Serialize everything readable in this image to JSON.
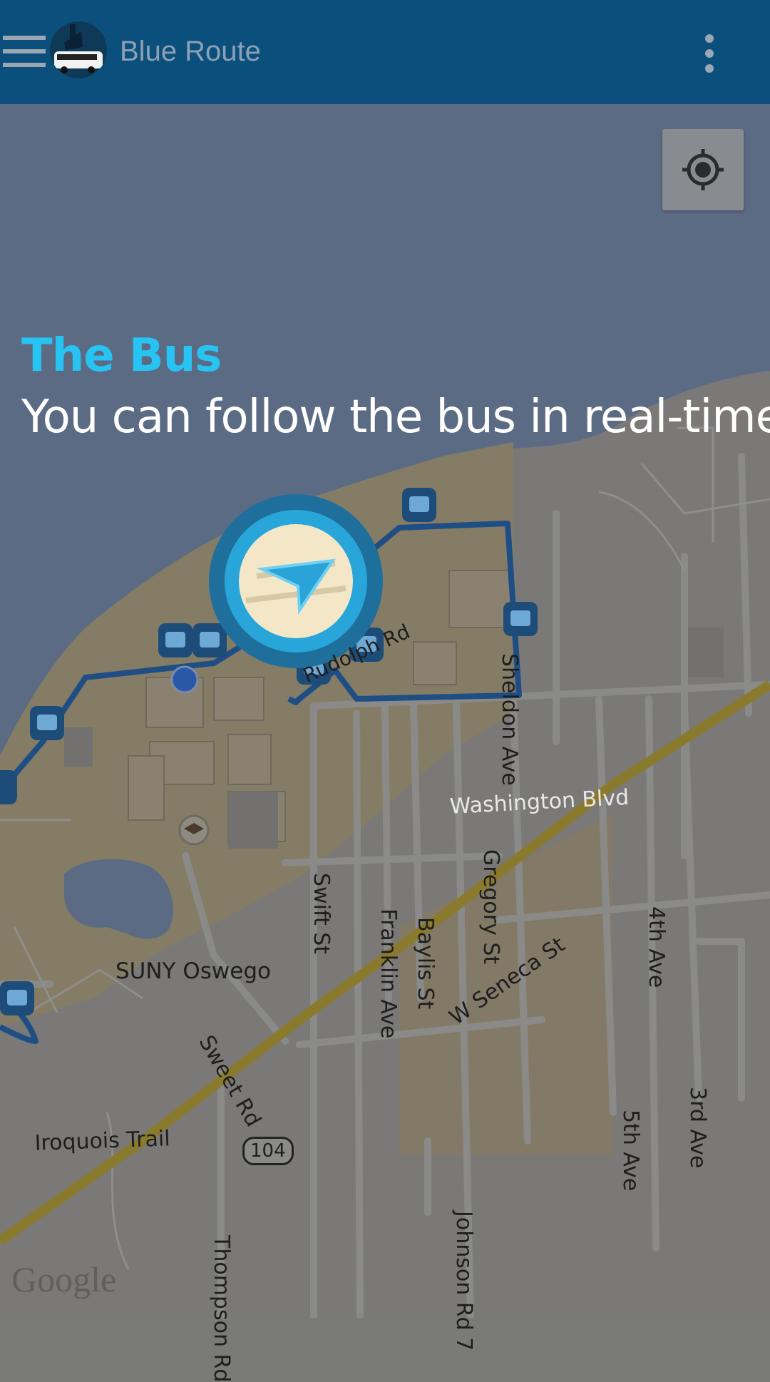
{
  "app_bar": {
    "title": "Blue Route",
    "menu_icon": "hamburger-menu-icon",
    "logo_icon": "bus-logo-icon",
    "overflow_icon": "more-vertical-icon"
  },
  "map": {
    "locate_button_icon": "my-location-icon",
    "attribution": "Google",
    "labels": {
      "suny": "SUNY Oswego",
      "washington": "Washington Blvd",
      "sheldon": "Sheldon Ave",
      "swift": "Swift St",
      "franklin": "Franklin Ave",
      "baylis": "Baylis St",
      "gregory": "Gregory St",
      "seneca": "W Seneca St",
      "fourth": "4th Ave",
      "fifth": "5th Ave",
      "third": "3rd Ave",
      "sweet": "Sweet Rd",
      "iroquois": "Iroquois Trail",
      "route104": "104",
      "thompson": "Thompson Rd",
      "johnson": "Johnson Rd 7",
      "rudolph": "Rudolph Rd"
    }
  },
  "tutorial": {
    "title": "The Bus",
    "body": "You can follow the bus in real-time"
  },
  "colors": {
    "app_bar": "#0b4f7c",
    "accent": "#27c3f3",
    "route": "#1f4e85",
    "highway": "#8a7a2e"
  }
}
